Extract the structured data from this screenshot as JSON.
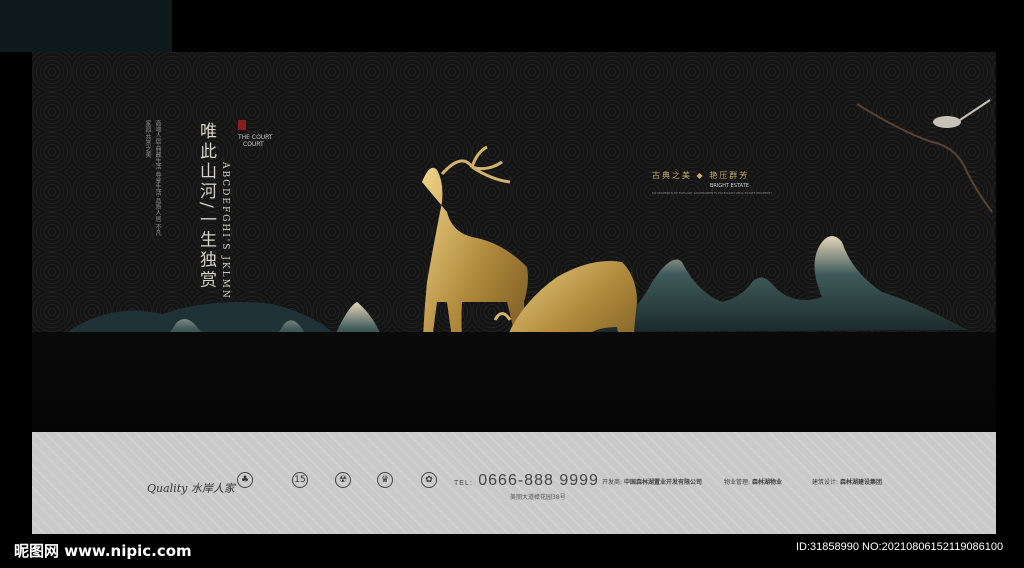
{
  "poster": {
    "main_title": "唯此山河/一生独赏",
    "eng_title": "ABCDEFGHI'S JKLMN",
    "tag_en": "THE COURT",
    "tag_en2": "COURT",
    "slogan_left": "古典之美",
    "slogan_right": "艳压群芳",
    "brand_sub": "BRIGHT ESTATE",
    "brand_small": "MY MOMENTS OF ELEGANT GOVERNMENTS EXCELLENT REAL ESTATE PROPERTY"
  },
  "footer": {
    "brand": "Quality 水岸人家",
    "phone_prefix": "TEL:",
    "phone": "0666-888 9999",
    "address": "美丽大道樟花园38号",
    "developer_label": "开发商:",
    "developer": "中国森林湖置业开发有限公司",
    "property_label": "物业管理:",
    "property": "森林湖物业",
    "design_label": "建筑设计:",
    "design": "森林湖建设集团",
    "logos": [
      "tree-logo",
      "15-logo",
      "crest-logo",
      "crown-logo",
      "flower-logo"
    ]
  },
  "watermark": {
    "left": "昵图网 www.nipic.com",
    "right": "ID:31858990 NO:20210806152119086100"
  }
}
